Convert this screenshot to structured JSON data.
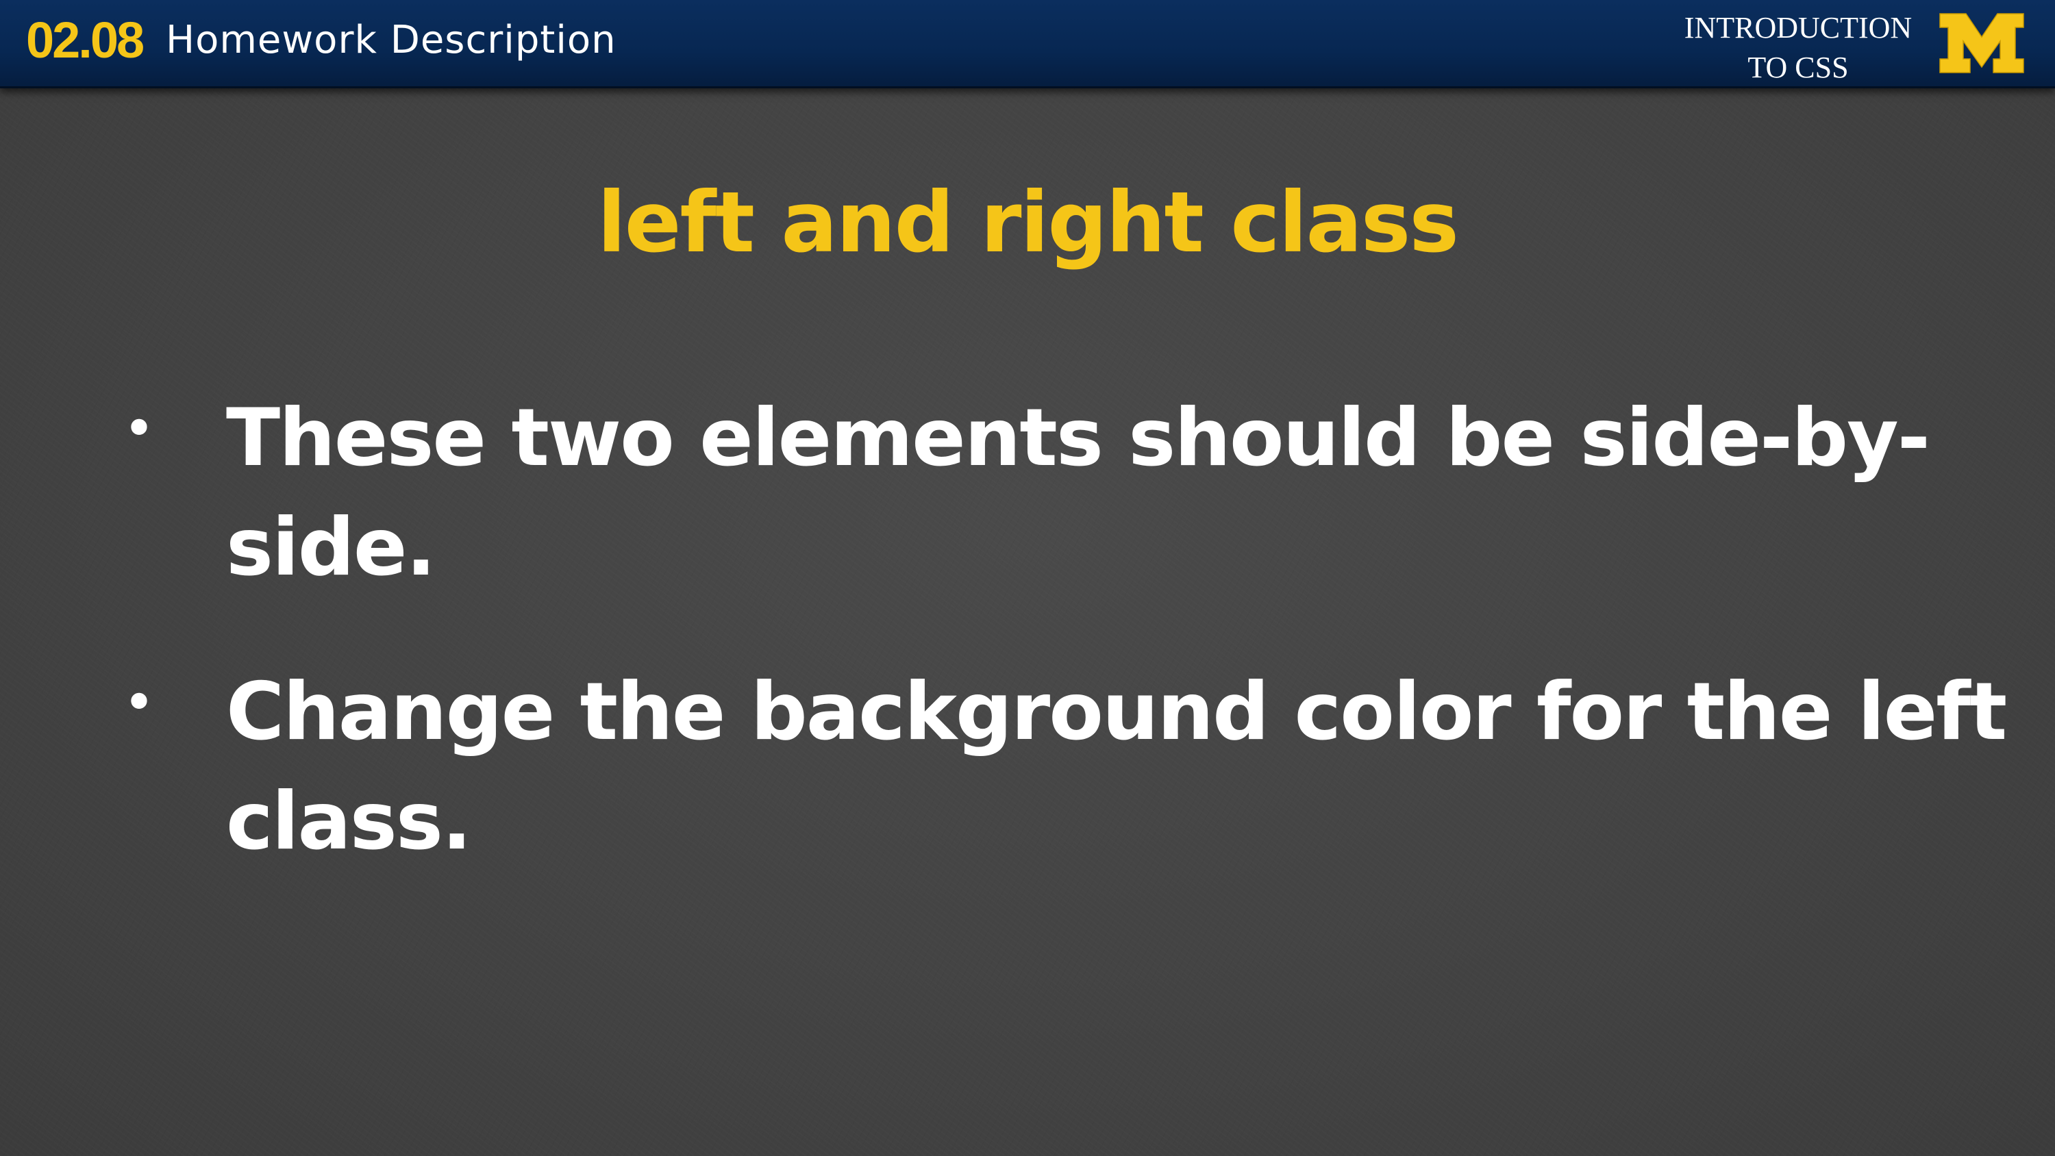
{
  "header": {
    "lesson_number": "02.08",
    "lesson_title": "Homework Description",
    "course_name_line1": "INTRODUCTION",
    "course_name_line2": "TO CSS",
    "logo_letter": "M"
  },
  "slide": {
    "heading": "left and right class",
    "bullets": [
      {
        "line1": "These two elements should be side-by-",
        "line2": "side."
      },
      {
        "line1": "Change the background color for the left",
        "line2": "class."
      }
    ]
  },
  "colors": {
    "header_bg": "#072752",
    "accent_maize": "#f5c518",
    "text": "#ffffff",
    "background": "#464646"
  }
}
